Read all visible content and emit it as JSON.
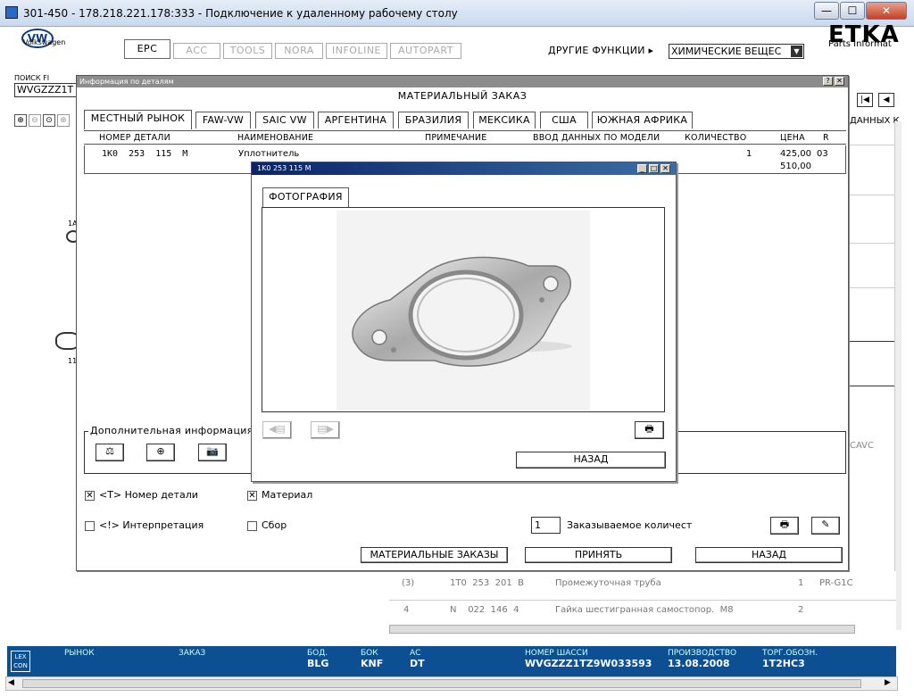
{
  "rdp": {
    "title": "301-450 - 178.218.221.178:333 - Подключение к удаленному рабочему столу",
    "min": "—",
    "max": "☐",
    "close": "✕"
  },
  "app": {
    "brand": "Volkswagen",
    "logo": "VW",
    "etka": "ETKA",
    "etka_sub": "Parts Informat",
    "tabs": [
      "EPC",
      "ACC",
      "TOOLS",
      "NORA",
      "INFOLINE",
      "AUTOPART"
    ],
    "other_functions": "ДРУГИЕ ФУНКЦИИ ▸",
    "chem_select": "ХИМИЧЕСКИЕ ВЕЩЕС",
    "search_label": "ПОИСК FI",
    "search_value": "WVGZZZ1T",
    "right_header": "ДАННЫХ К",
    "right_cavc": "CAVC",
    "left_label_1": "1A",
    "left_label_2": "11"
  },
  "bg_rows": [
    {
      "pos": "(3)",
      "part": "1T0  253  201  B",
      "name": "Промежуточная труба",
      "qty": "1",
      "code": "PR-G1C"
    },
    {
      "pos": "4",
      "part": "N    022  146  4",
      "name": "Гайка шестигранная самостопор.  M8",
      "qty": "2",
      "code": ""
    }
  ],
  "status": [
    {
      "label": "РЫНОК",
      "value": ""
    },
    {
      "label": "ЗАКАЗ",
      "value": ""
    },
    {
      "label": "БОД.",
      "value": "BLG"
    },
    {
      "label": "БОК",
      "value": "KNF"
    },
    {
      "label": "АС",
      "value": "DT"
    },
    {
      "label": "НОМЕР ШАССИ",
      "value": "WVGZZZ1TZ9W033593"
    },
    {
      "label": "ПРОИЗВОДСТВО",
      "value": "13.08.2008"
    },
    {
      "label": "ТОРГ.ОБОЗН.",
      "value": "1T2HC3"
    }
  ],
  "status_logo": "LEX CON",
  "dialog": {
    "title": "Информация по деталям",
    "heading": "МАТЕРИАЛЬНЫЙ ЗАКАЗ",
    "help": "?",
    "close": "✕",
    "tabs": [
      "МЕСТНЫЙ РЫНОК",
      "FAW-VW",
      "SAIC VW",
      "АРГЕНТИНА",
      "БРАЗИЛИЯ",
      "МЕКСИКА",
      "США",
      "ЮЖНАЯ АФРИКА"
    ],
    "columns": [
      "НОМЕР ДЕТАЛИ",
      "НАИМЕНОВАНИЕ",
      "ПРИМЕЧАНИЕ",
      "ВВОД ДАННЫХ ПО МОДЕЛИ",
      "КОЛИЧЕСТВО",
      "ЦЕНА",
      "R"
    ],
    "row": {
      "part": "1K0  253  115  M",
      "name": "Уплотнитель",
      "qty": "1",
      "price": "425,00",
      "r": "03",
      "price2": "510,00"
    },
    "extra_info": "Дополнительная информация",
    "cb_part": "<T> Номер детали",
    "cb_material": "Материал",
    "cb_interp": "<!> Интерпретация",
    "cb_assembly": "Сбор",
    "qty_value": "1",
    "qty_label": "Заказываемое количест",
    "btn_orders": "МАТЕРИАЛЬНЫЕ ЗАКАЗЫ",
    "btn_accept": "ПРИНЯТЬ",
    "btn_back": "НАЗАД"
  },
  "photo": {
    "title": "1K0 253 115 M",
    "tab": "ФОТОГРАФИЯ",
    "btn_back": "НАЗАД"
  }
}
